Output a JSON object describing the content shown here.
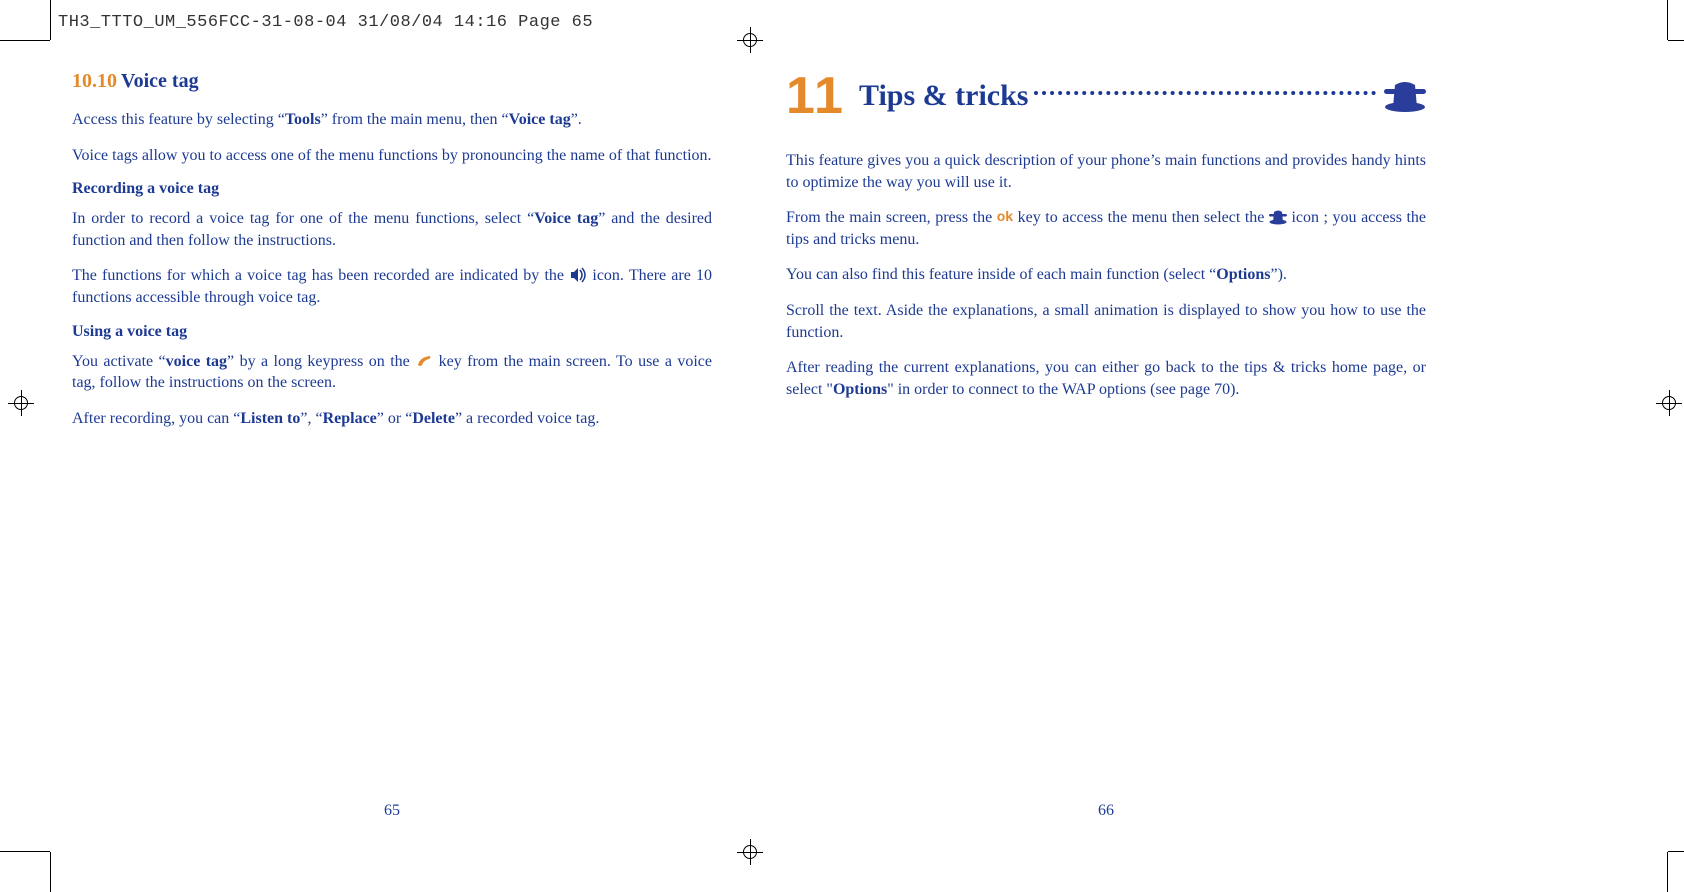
{
  "header": "TH3_TTTO_UM_556FCC-31-08-04  31/08/04  14:16  Page 65",
  "left": {
    "section_number": "10.10",
    "section_title": "Voice tag",
    "p1_a": "Access this feature by selecting “",
    "p1_b": "Tools",
    "p1_c": "” from the main menu, then “",
    "p1_d": "Voice tag",
    "p1_e": "”.",
    "p2": "Voice tags allow you to access one of the menu functions by pronouncing the name of that function.",
    "h1": "Recording a voice tag",
    "p3_a": "In order to record a voice tag for one of the menu functions, select “",
    "p3_b": "Voice tag",
    "p3_c": "” and the desired function and then follow the instructions.",
    "p4_a": "The functions for which a voice tag has been recorded are indicated by the ",
    "p4_b": " icon. There are 10 functions accessible through voice tag.",
    "h2": "Using a voice tag",
    "p5_a": "You activate “",
    "p5_b": "voice tag",
    "p5_c": "” by a long keypress on the ",
    "p5_d": " key from the main screen. To use a voice tag, follow the instructions on the screen.",
    "p6_a": "After recording, you can “",
    "p6_b": "Listen to",
    "p6_c": "”, “",
    "p6_d": "Replace",
    "p6_e": "” or “",
    "p6_f": "Delete",
    "p6_g": "” a recorded voice tag.",
    "page_number": "65"
  },
  "right": {
    "chapter_number": "11",
    "chapter_title": "Tips & tricks",
    "p1": "This feature gives you a quick description of your phone’s main functions and provides handy hints to optimize the way you will use it.",
    "p2_a": "From the main screen, press the ",
    "ok_label": "ok",
    "p2_b": " key to access the menu then select the ",
    "p2_c": " icon ; you access the tips and tricks menu.",
    "p3_a": "You can also find this feature inside of each main function (select “",
    "p3_b": "Options",
    "p3_c": "”).",
    "p4": "Scroll the text. Aside the explanations, a small animation is displayed to show you how to use the function.",
    "p5_a": "After reading the current explanations, you can either go back to the tips & tricks home page, or select \"",
    "p5_b": "Options",
    "p5_c": "\" in order to connect to the WAP options (see page 70).",
    "page_number": "66"
  },
  "icons": {
    "speaker_name": "speaker-icon",
    "phone_name": "phone-key-icon",
    "hat_name": "magic-hat-icon",
    "hat_small_name": "magic-hat-small-icon",
    "ok_name": "ok-key-icon"
  }
}
